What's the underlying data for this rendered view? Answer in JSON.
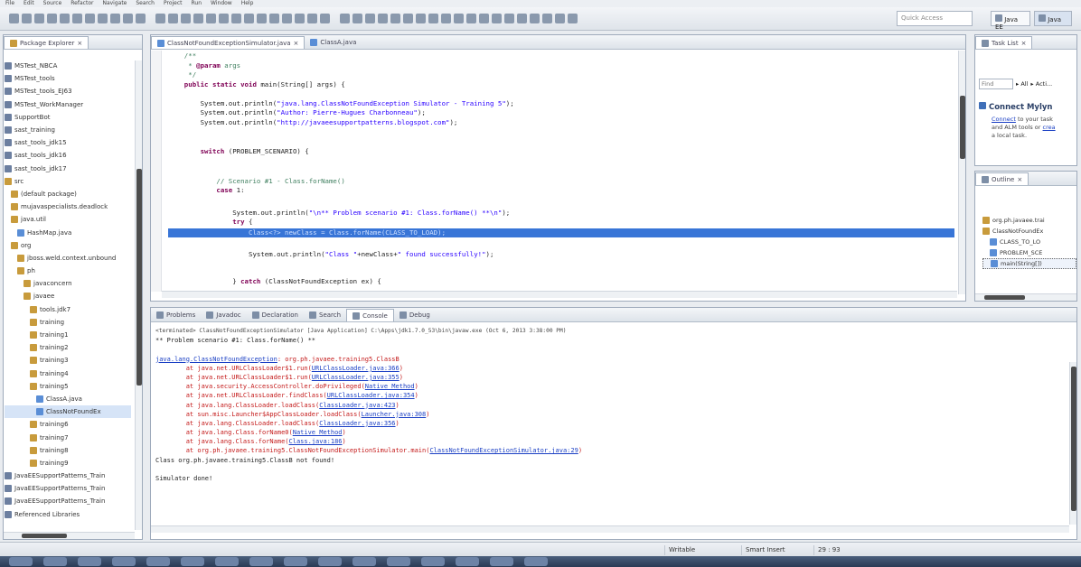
{
  "menubar": [
    "File",
    "Edit",
    "Source",
    "Refactor",
    "Navigate",
    "Search",
    "Project",
    "Run",
    "Window",
    "Help"
  ],
  "toolbar": {
    "quick_access_placeholder": "Quick Access",
    "perspectives": [
      "Java EE",
      "Java"
    ]
  },
  "package_explorer": {
    "tab": "Package Explorer",
    "items": [
      {
        "label": "MSTest_NBCA",
        "icon": "project-icon",
        "indent": 0
      },
      {
        "label": "MSTest_tools",
        "icon": "project-icon",
        "indent": 0
      },
      {
        "label": "MSTest_tools_EJ63",
        "icon": "project-icon",
        "indent": 0
      },
      {
        "label": "MSTest_WorkManager",
        "icon": "project-icon",
        "indent": 0
      },
      {
        "label": "SupportBot",
        "icon": "project-icon",
        "indent": 0
      },
      {
        "label": "sast_training",
        "icon": "project-icon",
        "indent": 0
      },
      {
        "label": "sast_tools_jdk15",
        "icon": "project-icon",
        "indent": 0
      },
      {
        "label": "sast_tools_jdk16",
        "icon": "project-icon",
        "indent": 0
      },
      {
        "label": "sast_tools_jdk17",
        "icon": "project-icon",
        "indent": 0
      },
      {
        "label": "src",
        "icon": "folder-icon",
        "indent": 0
      },
      {
        "label": "(default package)",
        "icon": "package-icon",
        "indent": 1
      },
      {
        "label": "mujavaspecialists.deadlock",
        "icon": "package-icon",
        "indent": 1
      },
      {
        "label": "java.util",
        "icon": "package-icon",
        "indent": 1
      },
      {
        "label": "HashMap.java",
        "icon": "java-file-icon",
        "indent": 2
      },
      {
        "label": "org",
        "icon": "package-icon",
        "indent": 1
      },
      {
        "label": "jboss.weld.context.unbound",
        "icon": "package-icon",
        "indent": 2
      },
      {
        "label": "ph",
        "icon": "package-icon",
        "indent": 2
      },
      {
        "label": "javaconcern",
        "icon": "package-icon",
        "indent": 3
      },
      {
        "label": "javaee",
        "icon": "package-icon",
        "indent": 3
      },
      {
        "label": "tools.jdk7",
        "icon": "package-icon",
        "indent": 4
      },
      {
        "label": "training",
        "icon": "package-icon",
        "indent": 4
      },
      {
        "label": "training1",
        "icon": "package-icon",
        "indent": 4
      },
      {
        "label": "training2",
        "icon": "package-icon",
        "indent": 4
      },
      {
        "label": "training3",
        "icon": "package-icon",
        "indent": 4
      },
      {
        "label": "training4",
        "icon": "package-icon",
        "indent": 4
      },
      {
        "label": "training5",
        "icon": "package-icon",
        "indent": 4
      },
      {
        "label": "ClassA.java",
        "icon": "java-file-icon",
        "indent": 5
      },
      {
        "label": "ClassNotFoundEx",
        "icon": "java-file-icon",
        "indent": 5,
        "selected": true
      },
      {
        "label": "training6",
        "icon": "package-icon",
        "indent": 4
      },
      {
        "label": "training7",
        "icon": "package-icon",
        "indent": 4
      },
      {
        "label": "training8",
        "icon": "package-icon",
        "indent": 4
      },
      {
        "label": "training9",
        "icon": "package-icon",
        "indent": 4
      },
      {
        "label": "JavaEESupportPatterns_Train",
        "icon": "project-icon",
        "indent": 0
      },
      {
        "label": "JavaEESupportPatterns_Train",
        "icon": "project-icon",
        "indent": 0
      },
      {
        "label": "JavaEESupportPatterns_Train",
        "icon": "project-icon",
        "indent": 0
      },
      {
        "label": "Referenced Libraries",
        "icon": "library-icon",
        "indent": 0
      }
    ]
  },
  "editor": {
    "tabs": [
      "ClassNotFoundExceptionSimulator.java",
      "ClassA.java"
    ],
    "lines": [
      [
        {
          "t": "    /**",
          "c": "cmt"
        }
      ],
      [
        {
          "t": "     * ",
          "c": "cmt"
        },
        {
          "t": "@param",
          "c": "kw"
        },
        {
          "t": " args",
          "c": "cmt"
        }
      ],
      [
        {
          "t": "     */",
          "c": "cmt"
        }
      ],
      [
        {
          "t": "    public static void",
          "c": "kw"
        },
        {
          "t": " main(String[] args) {",
          "c": ""
        }
      ],
      [
        {
          "t": "",
          "c": ""
        }
      ],
      [
        {
          "t": "        System.out.println(",
          "c": ""
        },
        {
          "t": "\"java.lang.ClassNotFoundException Simulator - Training 5\"",
          "c": "str"
        },
        {
          "t": ");",
          "c": ""
        }
      ],
      [
        {
          "t": "        System.out.println(",
          "c": ""
        },
        {
          "t": "\"Author: Pierre-Hugues Charbonneau\"",
          "c": "str"
        },
        {
          "t": ");",
          "c": ""
        }
      ],
      [
        {
          "t": "        System.out.println(",
          "c": ""
        },
        {
          "t": "\"http://javaeesupportpatterns.blogspot.com\"",
          "c": "str"
        },
        {
          "t": ");",
          "c": ""
        }
      ],
      [
        {
          "t": "",
          "c": ""
        }
      ],
      [
        {
          "t": "        switch",
          "c": "kw"
        },
        {
          "t": " (PROBLEM_SCENARIO) {",
          "c": ""
        }
      ],
      [
        {
          "t": "",
          "c": ""
        }
      ],
      [
        {
          "t": "            // Scenario #1 - Class.forName()",
          "c": "cmt"
        }
      ],
      [
        {
          "t": "            case",
          "c": "kw"
        },
        {
          "t": " 1:",
          "c": ""
        }
      ],
      [
        {
          "t": "",
          "c": ""
        }
      ],
      [
        {
          "t": "                System.out.println(",
          "c": ""
        },
        {
          "t": "\"\\n** Problem scenario #1: Class.forName() **\\n\"",
          "c": "str"
        },
        {
          "t": ");",
          "c": ""
        }
      ],
      [
        {
          "t": "                try",
          "c": "kw"
        },
        {
          "t": " {",
          "c": ""
        }
      ],
      [
        {
          "t": "                    Class<?> newClass = Class.forName(CLASS_TO_LOAD);",
          "c": "sel"
        }
      ],
      [
        {
          "t": "",
          "c": ""
        }
      ],
      [
        {
          "t": "                    System.out.println(",
          "c": ""
        },
        {
          "t": "\"Class \"",
          "c": "str"
        },
        {
          "t": "+newClass+",
          "c": ""
        },
        {
          "t": "\" found successfully!\"",
          "c": "str"
        },
        {
          "t": ");",
          "c": ""
        }
      ],
      [
        {
          "t": "",
          "c": ""
        }
      ],
      [
        {
          "t": "                } ",
          "c": ""
        },
        {
          "t": "catch",
          "c": "kw"
        },
        {
          "t": " (ClassNotFoundException ex) {",
          "c": ""
        }
      ]
    ]
  },
  "task_list": {
    "tab": "Task List",
    "find_placeholder": "Find",
    "filter_all": "All",
    "filter_activate": "Acti...",
    "mylyn_title": "Connect Mylyn",
    "mylyn_link": "Connect",
    "mylyn_text_1": " to your task",
    "mylyn_text_2": "and ALM tools or ",
    "mylyn_link_2": "crea",
    "mylyn_text_3": "a local task."
  },
  "outline": {
    "tab": "Outline",
    "items": [
      {
        "label": "org.ph.javaee.trai",
        "indent": 0
      },
      {
        "label": "ClassNotFoundEx",
        "indent": 0
      },
      {
        "label": "CLASS_TO_LO",
        "indent": 1
      },
      {
        "label": "PROBLEM_SCE",
        "indent": 1
      },
      {
        "label": "main(String[])",
        "indent": 1,
        "selected": true
      }
    ]
  },
  "bottom": {
    "tabs": [
      "Problems",
      "Javadoc",
      "Declaration",
      "Search",
      "Console",
      "Debug"
    ],
    "console_header": "<terminated> ClassNotFoundExceptionSimulator [Java Application] C:\\Apps\\jdk1.7.0_53\\bin\\javaw.exe (Oct 6, 2013 3:38:00 PM)",
    "console_lines": [
      {
        "t": "** Problem scenario #1: Class.forName() **",
        "c": ""
      },
      {
        "t": "",
        "c": ""
      },
      {
        "parts": [
          {
            "t": "java.lang.ClassNotFoundException",
            "c": "link"
          },
          {
            "t": ": org.ph.javaee.training5.ClassB",
            "c": "err"
          }
        ]
      },
      {
        "parts": [
          {
            "t": "\tat java.net.URLClassLoader$1.run(",
            "c": "err"
          },
          {
            "t": "URLClassLoader.java:366",
            "c": "link"
          },
          {
            "t": ")",
            "c": "err"
          }
        ]
      },
      {
        "parts": [
          {
            "t": "\tat java.net.URLClassLoader$1.run(",
            "c": "err"
          },
          {
            "t": "URLClassLoader.java:355",
            "c": "link"
          },
          {
            "t": ")",
            "c": "err"
          }
        ]
      },
      {
        "parts": [
          {
            "t": "\tat java.security.AccessController.doPrivileged(",
            "c": "err"
          },
          {
            "t": "Native Method",
            "c": "link"
          },
          {
            "t": ")",
            "c": "err"
          }
        ]
      },
      {
        "parts": [
          {
            "t": "\tat java.net.URLClassLoader.findClass(",
            "c": "err"
          },
          {
            "t": "URLClassLoader.java:354",
            "c": "link"
          },
          {
            "t": ")",
            "c": "err"
          }
        ]
      },
      {
        "parts": [
          {
            "t": "\tat java.lang.ClassLoader.loadClass(",
            "c": "err"
          },
          {
            "t": "ClassLoader.java:423",
            "c": "link"
          },
          {
            "t": ")",
            "c": "err"
          }
        ]
      },
      {
        "parts": [
          {
            "t": "\tat sun.misc.Launcher$AppClassLoader.loadClass(",
            "c": "err"
          },
          {
            "t": "Launcher.java:308",
            "c": "link"
          },
          {
            "t": ")",
            "c": "err"
          }
        ]
      },
      {
        "parts": [
          {
            "t": "\tat java.lang.ClassLoader.loadClass(",
            "c": "err"
          },
          {
            "t": "ClassLoader.java:356",
            "c": "link"
          },
          {
            "t": ")",
            "c": "err"
          }
        ]
      },
      {
        "parts": [
          {
            "t": "\tat java.lang.Class.forName0(",
            "c": "err"
          },
          {
            "t": "Native Method",
            "c": "link"
          },
          {
            "t": ")",
            "c": "err"
          }
        ]
      },
      {
        "parts": [
          {
            "t": "\tat java.lang.Class.forName(",
            "c": "err"
          },
          {
            "t": "Class.java:186",
            "c": "link"
          },
          {
            "t": ")",
            "c": "err"
          }
        ]
      },
      {
        "parts": [
          {
            "t": "\tat org.ph.javaee.training5.ClassNotFoundExceptionSimulator.main(",
            "c": "err"
          },
          {
            "t": "ClassNotFoundExceptionSimulator.java:29",
            "c": "link"
          },
          {
            "t": ")",
            "c": "err"
          }
        ]
      },
      {
        "t": "Class org.ph.javaee.training5.ClassB not found!",
        "c": ""
      },
      {
        "t": "",
        "c": ""
      },
      {
        "t": "Simulator done!",
        "c": ""
      }
    ]
  },
  "status": {
    "writable": "Writable",
    "insert_mode": "Smart Insert",
    "position": "29 : 93"
  },
  "colors": {
    "selection": "#3875d7",
    "keyword": "#7f0055",
    "string": "#2a00ff",
    "comment": "#3f7f5f",
    "error": "#c41a1a",
    "link": "#1a3fc4"
  }
}
